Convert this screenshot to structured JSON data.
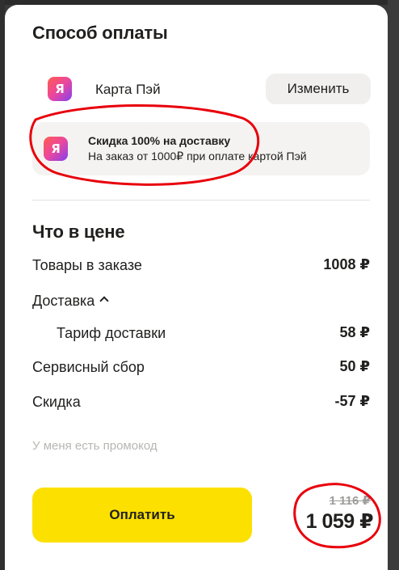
{
  "payment_section": {
    "title": "Способ оплаты",
    "method_icon_letter": "Я",
    "method_label": "Карта Пэй",
    "change_button_label": "Изменить"
  },
  "promo_banner": {
    "icon_letter": "Я",
    "title": "Скидка 100% на доставку",
    "subtitle": "На заказ от 1000₽ при оплате картой Пэй"
  },
  "price_section": {
    "title": "Что в цене",
    "rows": [
      {
        "label": "Товары в заказе",
        "value": "1008 ₽"
      },
      {
        "label": "Доставка",
        "value": ""
      },
      {
        "label": "Тариф доставки",
        "value": "58 ₽"
      },
      {
        "label": "Сервисный сбор",
        "value": "50 ₽"
      },
      {
        "label": "Скидка",
        "value": "-57 ₽"
      }
    ]
  },
  "promo_code_link": "У меня есть промокод",
  "checkout": {
    "pay_button_label": "Оплатить",
    "old_total": "1 116 ₽",
    "total": "1 059 ₽"
  },
  "colors": {
    "accent_yellow": "#fce000",
    "annotation_red": "#e8000b",
    "text_primary": "#21201f",
    "text_muted": "#b7b6b3"
  }
}
